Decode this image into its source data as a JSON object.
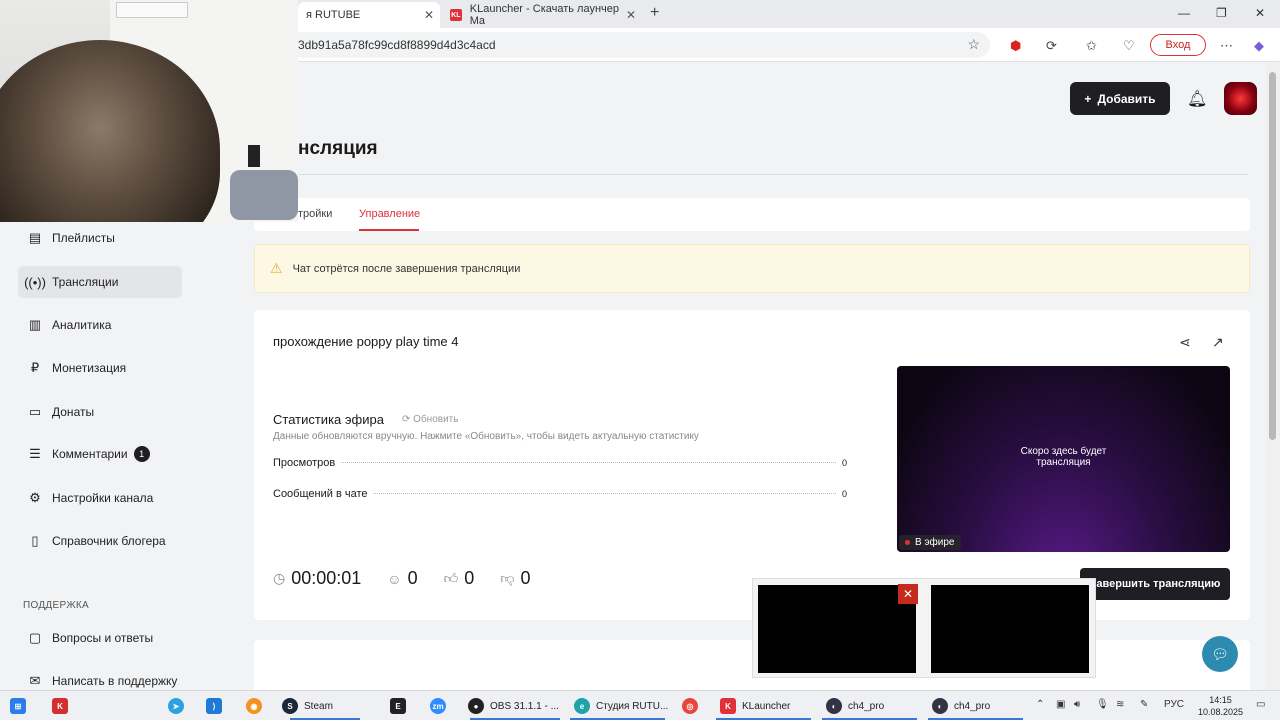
{
  "browser": {
    "tabs": [
      {
        "label": "я RUTUBE",
        "active": true
      },
      {
        "label": "KLauncher - Скачать лаунчер Ma",
        "active": false
      }
    ],
    "url": "3db91a5a78fc99cd8f8899d4d3c4acd",
    "login_label": "Вход"
  },
  "header": {
    "add_label": "Добавить",
    "page_title": "нсляция"
  },
  "page_tabs": [
    {
      "label": "тройки",
      "active": false
    },
    {
      "label": "Управление",
      "active": true
    }
  ],
  "sidebar": {
    "items": [
      {
        "label": "Плейлисты",
        "icon": "playlist-icon",
        "active": false
      },
      {
        "label": "Трансляции",
        "icon": "broadcast-icon",
        "active": true
      },
      {
        "label": "Аналитика",
        "icon": "analytics-icon",
        "active": false
      },
      {
        "label": "Монетизация",
        "icon": "monetization-icon",
        "active": false
      },
      {
        "label": "Донаты",
        "icon": "donations-icon",
        "active": false
      },
      {
        "label": "Комментарии",
        "icon": "comments-icon",
        "active": false,
        "badge": "1"
      },
      {
        "label": "Настройки канала",
        "icon": "settings-icon",
        "active": false
      },
      {
        "label": "Справочник блогера",
        "icon": "book-icon",
        "active": false
      }
    ],
    "support_label": "ПОДДЕРЖКА",
    "support_items": [
      {
        "label": "Вопросы и ответы",
        "icon": "faq-icon"
      },
      {
        "label": "Написать в поддержку",
        "icon": "mail-icon"
      }
    ]
  },
  "warning": {
    "text": "Чат сотрётся после завершения трансляции"
  },
  "stream": {
    "title": "прохождение poppy play time 4",
    "stats_title": "Статистика эфира",
    "refresh_label": "Обновить",
    "stats_note": "Данные обновляются вручную. Нажмите «Обновить», чтобы видеть актуальную статистику",
    "stats": [
      {
        "label": "Просмотров",
        "value": "0"
      },
      {
        "label": "Сообщений в чате",
        "value": "0"
      }
    ],
    "timer": "00:00:01",
    "viewers": "0",
    "likes": "0",
    "dislikes": "0",
    "preview_text_1": "Скоро здесь будет",
    "preview_text_2": "трансляция",
    "live_label": "В эфире",
    "end_label": "Завершить трансляцию"
  },
  "taskbar": {
    "apps": [
      {
        "label": "Steam"
      },
      {
        "label": "OBS 31.1.1 - ..."
      },
      {
        "label": "Студия RUTU..."
      },
      {
        "label": "KLauncher"
      },
      {
        "label": "ch4_pro"
      },
      {
        "label": "ch4_pro"
      }
    ],
    "lang": "РУС",
    "time": "14:15",
    "date": "10.08.2025"
  }
}
